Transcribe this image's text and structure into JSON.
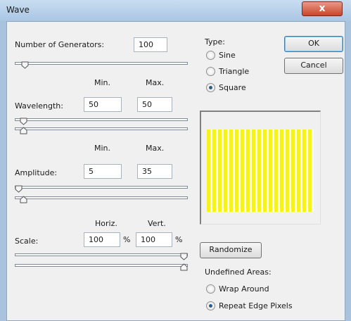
{
  "window": {
    "title": "Wave",
    "close_glyph": "x"
  },
  "generators": {
    "label": "Number of Generators:",
    "value": "100",
    "slider_level": 0.04
  },
  "type": {
    "label": "Type:",
    "options": [
      {
        "label": "Sine",
        "selected": false
      },
      {
        "label": "Triangle",
        "selected": false
      },
      {
        "label": "Square",
        "selected": true
      }
    ]
  },
  "buttons": {
    "ok": "OK",
    "cancel": "Cancel",
    "randomize": "Randomize"
  },
  "wavelength": {
    "min_header": "Min.",
    "max_header": "Max.",
    "label": "Wavelength:",
    "min": "50",
    "max": "50",
    "min_slider": 0.03,
    "max_slider": 0.03
  },
  "amplitude": {
    "min_header": "Min.",
    "max_header": "Max.",
    "label": "Amplitude:",
    "min": "5",
    "max": "35",
    "min_slider": 0.0,
    "max_slider": 0.03
  },
  "scale": {
    "horiz_header": "Horiz.",
    "vert_header": "Vert.",
    "label": "Scale:",
    "horiz": "100",
    "vert": "100",
    "unit": "%",
    "horiz_slider": 1.0,
    "vert_slider": 1.0
  },
  "undefined_areas": {
    "label": "Undefined Areas:",
    "options": [
      {
        "label": "Wrap Around",
        "selected": false
      },
      {
        "label": "Repeat Edge Pixels",
        "selected": true
      }
    ]
  },
  "preview": {
    "stripe_color": "#f7f21b",
    "background_color": "#ffffff",
    "stripe_count": 19
  },
  "icons": {
    "thumb": "slider-thumb-icon",
    "close": "close-icon"
  }
}
